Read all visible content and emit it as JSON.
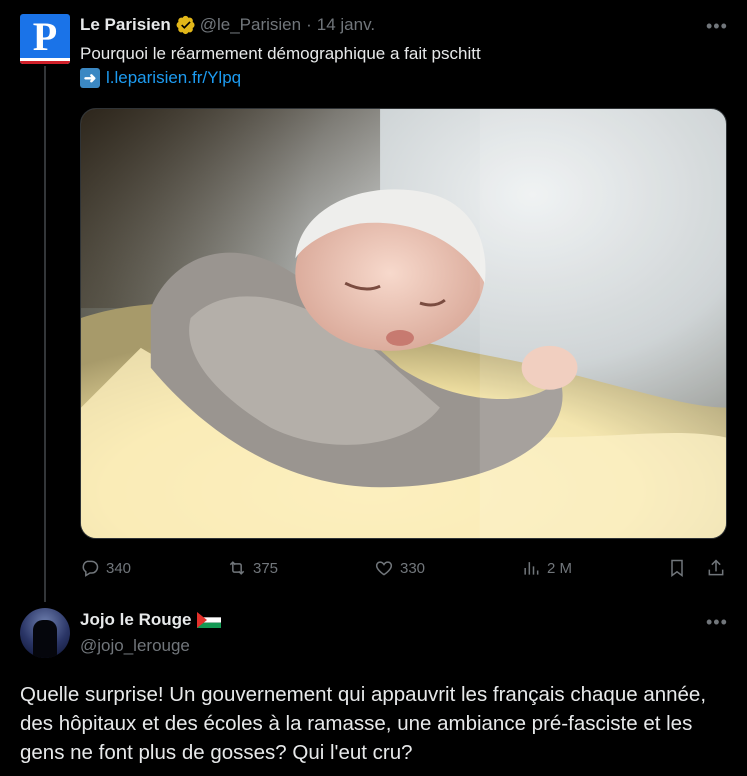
{
  "tweet1": {
    "author_name": "Le Parisien",
    "author_handle": "@le_Parisien",
    "separator": "·",
    "date": "14 janv.",
    "avatar_letter": "P",
    "text": "Pourquoi le réarmement démographique a fait pschitt",
    "link_icon": "right-arrow-emoji",
    "link_text": "l.leparisien.fr/Ylpq",
    "media_description_icon": "newborn-photo",
    "stats": {
      "replies": "340",
      "reposts": "375",
      "likes": "330",
      "views": "2 M"
    }
  },
  "tweet2": {
    "author_name": "Jojo le Rouge",
    "author_handle": "@jojo_lerouge",
    "flag_icon": "palestine-flag",
    "text": "Quelle surprise! Un gouvernement qui appauvrit les français chaque année, des hôpitaux et des écoles à la ramasse, une ambiance pré-fasciste et les gens ne font plus de gosses? Qui l'eut cru?"
  },
  "colors": {
    "background": "#000000",
    "text": "#e7e9ea",
    "muted": "#71767b",
    "link": "#1d9bf0",
    "verified_gold": "#e2b719",
    "divider": "#2f3336"
  }
}
